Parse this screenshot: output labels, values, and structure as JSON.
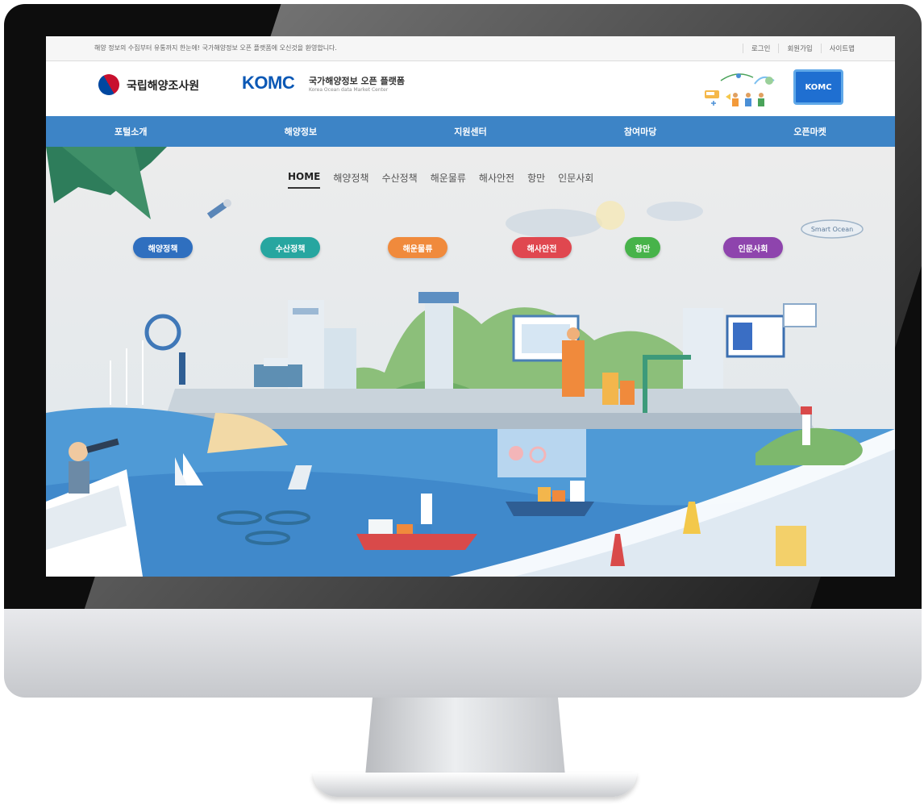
{
  "util_bar": {
    "notice": "해양 정보의 수집부터 유통까지 한눈에! 국가해양정보 오픈 플랫폼에 오신것을 환영합니다.",
    "links": [
      "로그인",
      "회원가입",
      "사이트맵"
    ]
  },
  "header": {
    "org_name": "국립해양조사원",
    "brand": "KOMC",
    "platform_title": "국가해양정보 오픈 플랫폼",
    "platform_subtitle": "Korea Ocean data Market Center",
    "screen_label": "KOMC"
  },
  "main_nav": [
    "포털소개",
    "해양정보",
    "지원센터",
    "참여마당",
    "오픈마켓"
  ],
  "sub_nav": [
    "HOME",
    "해양정책",
    "수산정책",
    "해운물류",
    "해사안전",
    "항만",
    "인문사회"
  ],
  "category_pills": [
    {
      "label": "해양정책",
      "color": "#2f6fbf"
    },
    {
      "label": "수산정책",
      "color": "#27a6a0"
    },
    {
      "label": "해운물류",
      "color": "#f08a3c"
    },
    {
      "label": "해사안전",
      "color": "#e0474f"
    },
    {
      "label": "항만",
      "color": "#47b34a"
    },
    {
      "label": "인문사회",
      "color": "#8e44ad"
    }
  ],
  "airship_label": "Smart Ocean",
  "colors": {
    "nav_blue": "#3d84c6",
    "brand_blue": "#0b58b5",
    "sea": "#4f9ad6"
  }
}
